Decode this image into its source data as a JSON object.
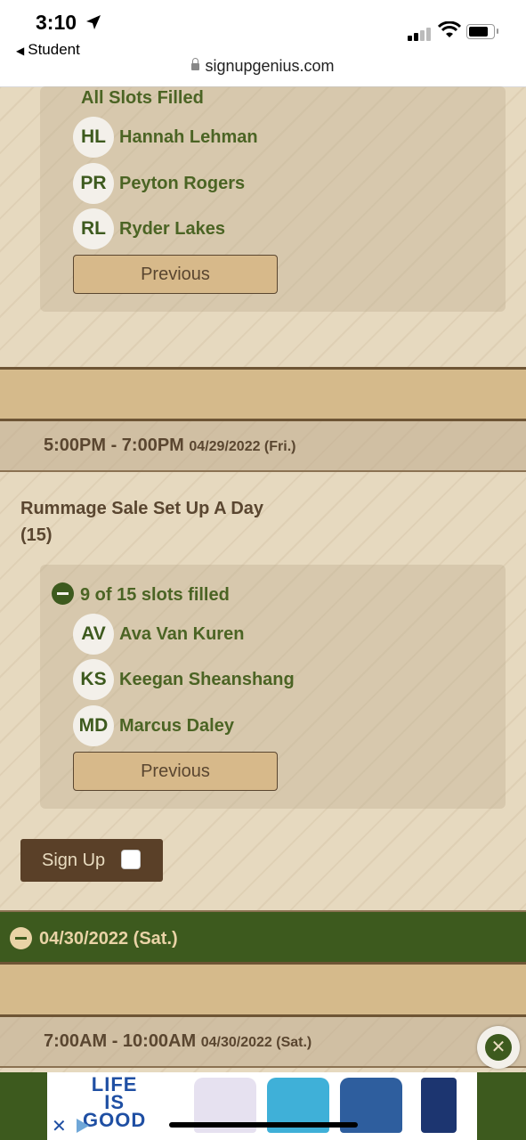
{
  "status_bar": {
    "time": "3:10",
    "back_label": "Student",
    "url": "signupgenius.com"
  },
  "panel1": {
    "heading": "All Slots Filled",
    "people": [
      {
        "initials": "HL",
        "name": "Hannah Lehman"
      },
      {
        "initials": "PR",
        "name": "Peyton Rogers"
      },
      {
        "initials": "RL",
        "name": "Ryder Lakes"
      }
    ],
    "previous_label": "Previous"
  },
  "timeslot1": {
    "time": "5:00PM - 7:00PM",
    "date": "04/29/2022 (Fri.)"
  },
  "slot": {
    "title": "Rummage Sale Set Up A Day",
    "count": "(15)"
  },
  "panel2": {
    "heading": "9 of 15 slots filled",
    "people": [
      {
        "initials": "AV",
        "name": "Ava Van Kuren"
      },
      {
        "initials": "KS",
        "name": "Keegan Sheanshang"
      },
      {
        "initials": "MD",
        "name": "Marcus Daley"
      }
    ],
    "previous_label": "Previous"
  },
  "signup_label": "Sign Up",
  "date_header": "04/30/2022 (Sat.)",
  "timeslot2": {
    "time": "7:00AM - 10:00AM",
    "date": "04/30/2022 (Sat.)"
  },
  "ad": {
    "logo_lines": [
      "LIFE",
      "IS",
      "GOOD"
    ]
  },
  "colors": {
    "green": "#3d5a1e",
    "brown": "#5a4028",
    "tan": "#d5ba8b"
  }
}
